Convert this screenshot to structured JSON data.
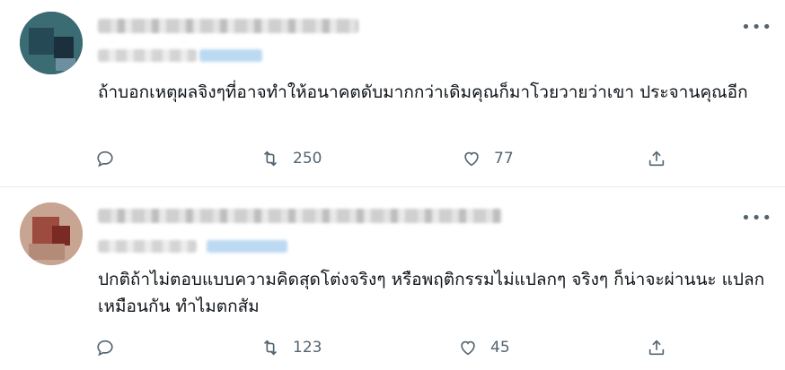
{
  "replies": [
    {
      "text": "ถ้าบอกเหตุผลจิงๆที่อาจทำให้อนาคตดับมากกว่าเดิมคุณก็มาโวยวายว่าเขา ประจานคุณอีก",
      "more_label": "•••",
      "reply_icon": "reply-icon",
      "retweet_count": "250",
      "like_count": "77",
      "share_icon": "share-icon"
    },
    {
      "text": "ปกติถ้าไม่ตอบแบบความคิดสุดโต่งจริงๆ หรือพฤติกรรมไม่แปลกๆ จริงๆ ก็น่าจะผ่านนะ แปลกเหมือนกัน ทำไมตกสัม",
      "more_label": "•••",
      "reply_icon": "reply-icon",
      "retweet_count": "123",
      "like_count": "45",
      "share_icon": "share-icon"
    }
  ],
  "colors": {
    "text": "#0f1419",
    "muted": "#536471",
    "divider": "#e6ecf0"
  }
}
